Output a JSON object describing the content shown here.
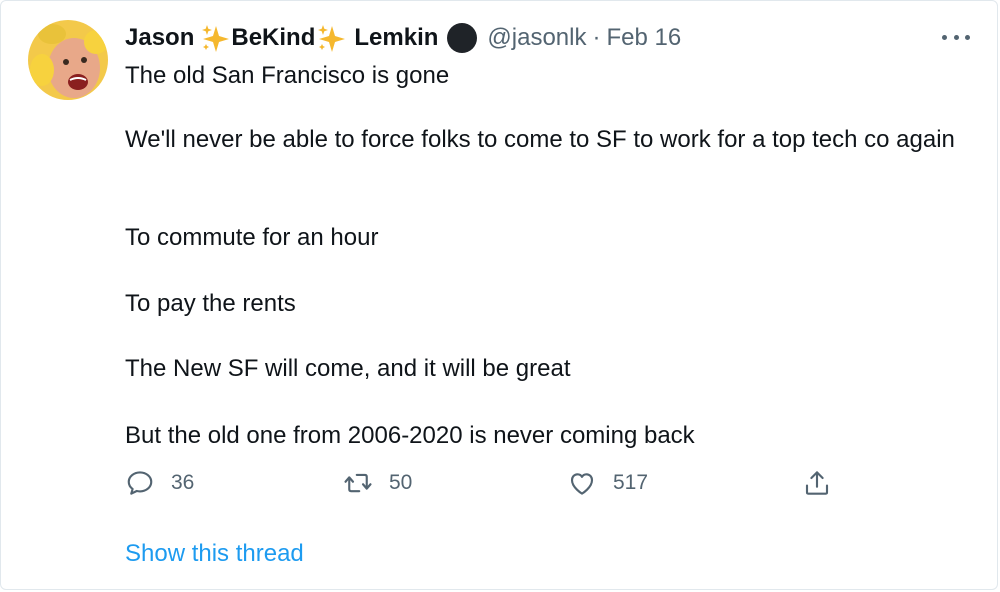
{
  "author": {
    "name_first": "Jason",
    "name_middle": "BeKind",
    "name_last": "Lemkin",
    "handle": "@jasonlk",
    "separator": "·",
    "date": "Feb 16"
  },
  "tweet": {
    "paragraphs": [
      "The old San Francisco is gone",
      "We'll never be able to force folks to come to SF to work for a top tech co again",
      "To commute for an hour",
      "To pay the rents",
      "The New SF will come, and it will be great",
      "But the old one from 2006-2020 is never coming back"
    ]
  },
  "actions": {
    "reply_count": "36",
    "retweet_count": "50",
    "like_count": "517"
  },
  "thread_link": "Show this thread",
  "colors": {
    "link": "#1d9bf0",
    "muted": "#536471",
    "text": "#0f1419",
    "sparkle": "#f5b82e"
  },
  "icons": {
    "reply": "speech-bubble-icon",
    "retweet": "retweet-icon",
    "like": "heart-icon",
    "share": "share-icon",
    "more": "more-dots-icon",
    "sparkle": "sparkles-emoji"
  }
}
